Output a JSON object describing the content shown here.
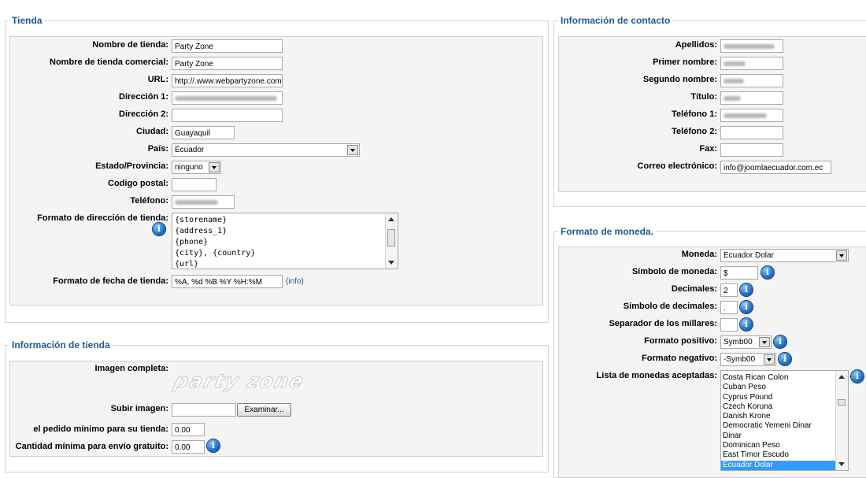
{
  "tienda": {
    "legend": "Tienda",
    "fields": {
      "nombre": {
        "label": "Nombre de tienda:",
        "value": "Party Zone"
      },
      "nombre_comercial": {
        "label": "Nombre de tienda comercial:",
        "value": "Party Zone"
      },
      "url": {
        "label": "URL:",
        "value": "http://.www.webpartyzone.com"
      },
      "direccion1": {
        "label": "Dirección 1:"
      },
      "direccion2": {
        "label": "Dirección 2:",
        "value": ""
      },
      "ciudad": {
        "label": "Ciudad:",
        "value": "Guayaquil"
      },
      "pais": {
        "label": "País:",
        "value": "Ecuador"
      },
      "estado": {
        "label": "Estado/Provincia:",
        "value": "ninguno"
      },
      "codigo_postal": {
        "label": "Codigo postal:",
        "value": ""
      },
      "telefono": {
        "label": "Teléfono:"
      },
      "formato_direccion": {
        "label": "Formato de dirección de tienda:",
        "lines": [
          "{storename}",
          "{address_1}",
          "{phone}",
          "{city}, {country}",
          "{url}"
        ]
      },
      "formato_fecha": {
        "label": "Formato de fecha de tienda:",
        "value": "%A, %d %B %Y %H:%M",
        "link": "(info)"
      }
    }
  },
  "info_tienda": {
    "legend": "Información de tienda",
    "imagen_label": "Imagen completa:",
    "logo_text": "party zone",
    "subir_label": "Subir imagen:",
    "examinar": "Examinar...",
    "pedido_minimo": {
      "label": "el pedido mínimo para su tienda:",
      "value": "0.00"
    },
    "envio_gratuito": {
      "label": "Cantidad mínima para envío gratuito:",
      "value": "0.00"
    }
  },
  "contacto": {
    "legend": "Información de contacto",
    "apellidos": {
      "label": "Apellidos:"
    },
    "primer_nombre": {
      "label": "Primer nombre:"
    },
    "segundo_nombre": {
      "label": "Segundo nombre:"
    },
    "titulo": {
      "label": "Título:"
    },
    "telefono1": {
      "label": "Teléfono 1:"
    },
    "telefono2": {
      "label": "Teléfono 2:",
      "value": ""
    },
    "fax": {
      "label": "Fax:",
      "value": ""
    },
    "correo": {
      "label": "Correo electrónico:",
      "value": "info@joomlaecuador.com.ec"
    }
  },
  "moneda": {
    "legend": "Formato de moneda.",
    "moneda": {
      "label": "Moneda:",
      "value": "Ecuador Dolar"
    },
    "simbolo": {
      "label": "Símbolo de moneda:",
      "value": "$"
    },
    "decimales": {
      "label": "Decimales:",
      "value": "2"
    },
    "simbolo_decimales": {
      "label": "Símbolo de decimales:",
      "value": "."
    },
    "separador_millares": {
      "label": "Separador de los millares:",
      "value": ""
    },
    "formato_positivo": {
      "label": "Formato positivo:",
      "value": "Symb00"
    },
    "formato_negativo": {
      "label": "Formato negativo:",
      "value": "-Symb00"
    },
    "lista": {
      "label": "Lista de monedas aceptadas:",
      "options": [
        "Costa Rican Colon",
        "Cuban Peso",
        "Cyprus Pound",
        "Czech Koruna",
        "Danish Krone",
        "Democratic Yemeni Dinar",
        "Dinar",
        "Dominican Peso",
        "East Timor Escudo",
        "Ecuador Dolar"
      ],
      "selected": "Ecuador Dolar"
    }
  },
  "colors": {
    "legend": "#1f5b8f",
    "panel": "#f4f4f4",
    "info_icon": "#1d6fc4",
    "selected_option": "#3399ff"
  },
  "icons": {
    "info": "info-icon",
    "dropdown": "chevron-down-icon"
  },
  "info_glyph": "i"
}
